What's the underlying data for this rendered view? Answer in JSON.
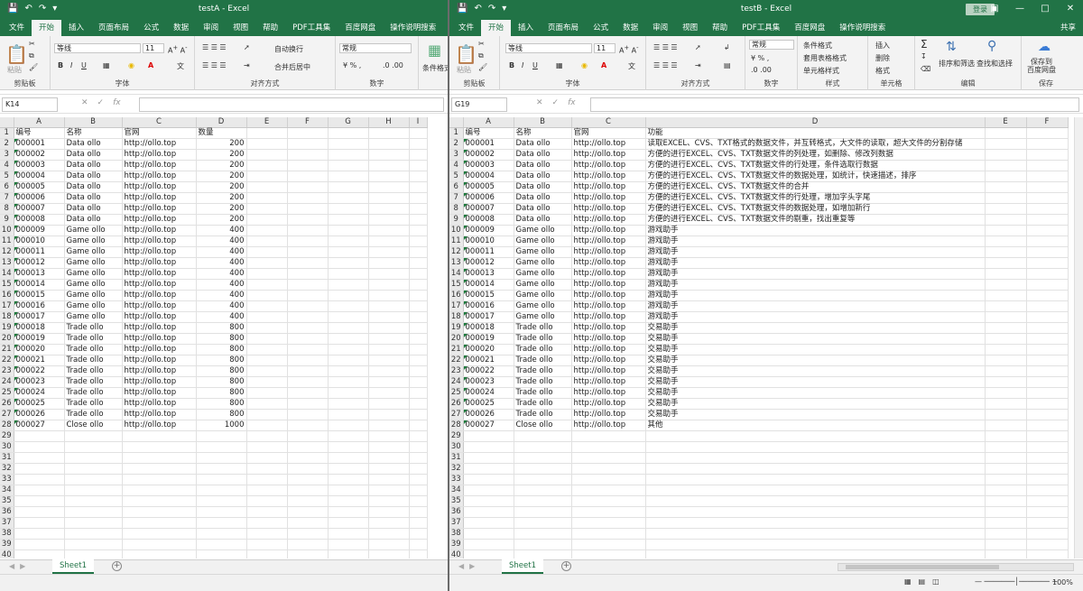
{
  "left": {
    "title": "testA  -  Excel",
    "tabs": [
      "文件",
      "开始",
      "插入",
      "页面布局",
      "公式",
      "数据",
      "审阅",
      "视图",
      "帮助",
      "PDF工具集",
      "百度网盘",
      "操作说明搜索"
    ],
    "active_tab": "开始",
    "ribbon": {
      "paste": "粘贴",
      "clipboard": "剪贴板",
      "font_name": "等线",
      "font_size": "11",
      "font_group": "字体",
      "wrap": "自动换行",
      "merge": "合并后居中",
      "align_group": "对齐方式",
      "numfmt": "常规",
      "number_group": "数字",
      "cond": "条件格式"
    },
    "name_box": "K14",
    "columns": [
      "A",
      "B",
      "C",
      "D",
      "E",
      "F",
      "G",
      "H",
      "I"
    ],
    "sheet_tab": "Sheet1",
    "rows": [
      [
        "编号",
        "名称",
        "官网",
        "数量"
      ],
      [
        "000001",
        "Data ollo",
        "http://ollo.top",
        "200"
      ],
      [
        "000002",
        "Data ollo",
        "http://ollo.top",
        "200"
      ],
      [
        "000003",
        "Data ollo",
        "http://ollo.top",
        "200"
      ],
      [
        "000004",
        "Data ollo",
        "http://ollo.top",
        "200"
      ],
      [
        "000005",
        "Data ollo",
        "http://ollo.top",
        "200"
      ],
      [
        "000006",
        "Data ollo",
        "http://ollo.top",
        "200"
      ],
      [
        "000007",
        "Data ollo",
        "http://ollo.top",
        "200"
      ],
      [
        "000008",
        "Data ollo",
        "http://ollo.top",
        "200"
      ],
      [
        "000009",
        "Game ollo",
        "http://ollo.top",
        "400"
      ],
      [
        "000010",
        "Game ollo",
        "http://ollo.top",
        "400"
      ],
      [
        "000011",
        "Game ollo",
        "http://ollo.top",
        "400"
      ],
      [
        "000012",
        "Game ollo",
        "http://ollo.top",
        "400"
      ],
      [
        "000013",
        "Game ollo",
        "http://ollo.top",
        "400"
      ],
      [
        "000014",
        "Game ollo",
        "http://ollo.top",
        "400"
      ],
      [
        "000015",
        "Game ollo",
        "http://ollo.top",
        "400"
      ],
      [
        "000016",
        "Game ollo",
        "http://ollo.top",
        "400"
      ],
      [
        "000017",
        "Game ollo",
        "http://ollo.top",
        "400"
      ],
      [
        "000018",
        "Trade ollo",
        "http://ollo.top",
        "800"
      ],
      [
        "000019",
        "Trade ollo",
        "http://ollo.top",
        "800"
      ],
      [
        "000020",
        "Trade ollo",
        "http://ollo.top",
        "800"
      ],
      [
        "000021",
        "Trade ollo",
        "http://ollo.top",
        "800"
      ],
      [
        "000022",
        "Trade ollo",
        "http://ollo.top",
        "800"
      ],
      [
        "000023",
        "Trade ollo",
        "http://ollo.top",
        "800"
      ],
      [
        "000024",
        "Trade ollo",
        "http://ollo.top",
        "800"
      ],
      [
        "000025",
        "Trade ollo",
        "http://ollo.top",
        "800"
      ],
      [
        "000026",
        "Trade ollo",
        "http://ollo.top",
        "800"
      ],
      [
        "000027",
        "Close ollo",
        "http://ollo.top",
        "1000"
      ]
    ]
  },
  "right": {
    "title": "testB  -  Excel",
    "login": "登录",
    "share": "共享",
    "tabs": [
      "文件",
      "开始",
      "插入",
      "页面布局",
      "公式",
      "数据",
      "审阅",
      "视图",
      "帮助",
      "PDF工具集",
      "百度网盘",
      "操作说明搜索"
    ],
    "active_tab": "开始",
    "ribbon": {
      "paste": "粘贴",
      "clipboard": "剪贴板",
      "font_name": "等线",
      "font_size": "11",
      "font_group": "字体",
      "align_group": "对齐方式",
      "numfmt": "常规",
      "number_group": "数字",
      "cond": "条件格式",
      "table_fmt": "套用表格格式",
      "cell_style": "单元格样式",
      "style_group": "样式",
      "insert": "插入",
      "delete": "删除",
      "format": "格式",
      "cells_group": "单元格",
      "sort": "排序和筛选",
      "find": "查找和选择",
      "edit_group": "编辑",
      "save_baidu": "保存到\n百度网盘",
      "save_group": "保存"
    },
    "name_box": "G19",
    "columns": [
      "A",
      "B",
      "C",
      "D",
      "E",
      "F"
    ],
    "sheet_tab": "Sheet1",
    "zoom": "100%",
    "rows": [
      [
        "编号",
        "名称",
        "官网",
        "功能"
      ],
      [
        "000001",
        "Data ollo",
        "http://ollo.top",
        "读取EXCEL、CVS、TXT格式的数据文件，并互转格式，大文件的读取，超大文件的分割存储"
      ],
      [
        "000002",
        "Data ollo",
        "http://ollo.top",
        "方便的进行EXCEL、CVS、TXT数据文件的列处理，如删除、修改列数据"
      ],
      [
        "000003",
        "Data ollo",
        "http://ollo.top",
        "方便的进行EXCEL、CVS、TXT数据文件的行处理，条件选取行数据"
      ],
      [
        "000004",
        "Data ollo",
        "http://ollo.top",
        "方便的进行EXCEL、CVS、TXT数据文件的数据处理，如统计，快速描述，排序"
      ],
      [
        "000005",
        "Data ollo",
        "http://ollo.top",
        "方便的进行EXCEL、CVS、TXT数据文件的合并"
      ],
      [
        "000006",
        "Data ollo",
        "http://ollo.top",
        "方便的进行EXCEL、CVS、TXT数据文件的行处理，增加字头字尾"
      ],
      [
        "000007",
        "Data ollo",
        "http://ollo.top",
        "方便的进行EXCEL、CVS、TXT数据文件的数据处理，如增加新行"
      ],
      [
        "000008",
        "Data ollo",
        "http://ollo.top",
        "方便的进行EXCEL、CVS、TXT数据文件的剔重，找出重复等"
      ],
      [
        "000009",
        "Game ollo",
        "http://ollo.top",
        "游戏助手"
      ],
      [
        "000010",
        "Game ollo",
        "http://ollo.top",
        "游戏助手"
      ],
      [
        "000011",
        "Game ollo",
        "http://ollo.top",
        "游戏助手"
      ],
      [
        "000012",
        "Game ollo",
        "http://ollo.top",
        "游戏助手"
      ],
      [
        "000013",
        "Game ollo",
        "http://ollo.top",
        "游戏助手"
      ],
      [
        "000014",
        "Game ollo",
        "http://ollo.top",
        "游戏助手"
      ],
      [
        "000015",
        "Game ollo",
        "http://ollo.top",
        "游戏助手"
      ],
      [
        "000016",
        "Game ollo",
        "http://ollo.top",
        "游戏助手"
      ],
      [
        "000017",
        "Game ollo",
        "http://ollo.top",
        "游戏助手"
      ],
      [
        "000018",
        "Trade ollo",
        "http://ollo.top",
        "交易助手"
      ],
      [
        "000019",
        "Trade ollo",
        "http://ollo.top",
        "交易助手"
      ],
      [
        "000020",
        "Trade ollo",
        "http://ollo.top",
        "交易助手"
      ],
      [
        "000021",
        "Trade ollo",
        "http://ollo.top",
        "交易助手"
      ],
      [
        "000022",
        "Trade ollo",
        "http://ollo.top",
        "交易助手"
      ],
      [
        "000023",
        "Trade ollo",
        "http://ollo.top",
        "交易助手"
      ],
      [
        "000024",
        "Trade ollo",
        "http://ollo.top",
        "交易助手"
      ],
      [
        "000025",
        "Trade ollo",
        "http://ollo.top",
        "交易助手"
      ],
      [
        "000026",
        "Trade ollo",
        "http://ollo.top",
        "交易助手"
      ],
      [
        "000027",
        "Close ollo",
        "http://ollo.top",
        "其他"
      ]
    ]
  },
  "total_rows": 40
}
